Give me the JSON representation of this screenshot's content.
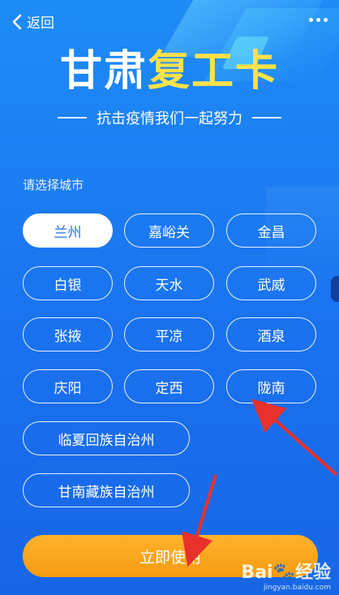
{
  "topbar": {
    "back_label": "返回"
  },
  "title": {
    "part1": "甘肃",
    "part2": "复工卡"
  },
  "subtitle": "抗击疫情我们一起努力",
  "prompt": "请选择城市",
  "cities": [
    {
      "label": "兰州",
      "selected": true
    },
    {
      "label": "嘉峪关"
    },
    {
      "label": "金昌"
    },
    {
      "label": "白银"
    },
    {
      "label": "天水"
    },
    {
      "label": "武威"
    },
    {
      "label": "张掖"
    },
    {
      "label": "平凉"
    },
    {
      "label": "酒泉"
    },
    {
      "label": "庆阳"
    },
    {
      "label": "定西"
    },
    {
      "label": "陇南"
    },
    {
      "label": "临夏回族自治州"
    },
    {
      "label": "甘南藏族自治州"
    }
  ],
  "use_button": "立即使用",
  "watermark": {
    "logo_text": "Bai",
    "logo_text2": "经验",
    "url": "jingyan.baidu.com"
  },
  "colors": {
    "background": "#1a72ef",
    "accent_yellow": "#ffe24a",
    "button_orange": "#f59b12",
    "arrow_red": "#e8312a"
  }
}
